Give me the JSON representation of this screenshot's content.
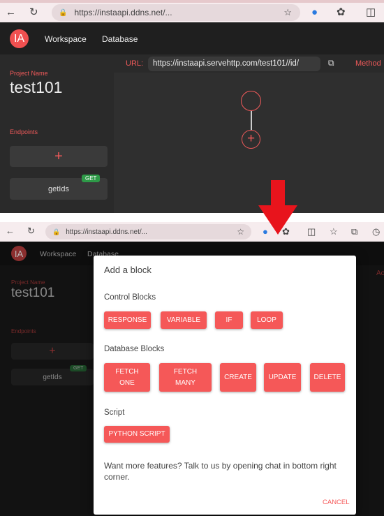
{
  "browser": {
    "url": "https://instaapi.ddns.net/..."
  },
  "app": {
    "logo": "IA",
    "nav": [
      "Workspace",
      "Database"
    ]
  },
  "sidebar": {
    "project_label": "Project Name",
    "project_name": "test101",
    "endpoints_label": "Endpoints",
    "add_symbol": "+",
    "endpoint": {
      "name": "getIds",
      "method": "GET"
    }
  },
  "toolbar": {
    "url_label": "URL:",
    "url_value": "https://instaapi.servehttp.com/test101//id/",
    "method_label": "Method",
    "partial_label": "Ac"
  },
  "canvas": {
    "add_symbol": "+"
  },
  "modal": {
    "title": "Add a block",
    "control_label": "Control Blocks",
    "control": [
      "RESPONSE",
      "VARIABLE",
      "IF",
      "LOOP"
    ],
    "database_label": "Database Blocks",
    "database": [
      "FETCH ONE",
      "FETCH MANY",
      "CREATE",
      "UPDATE",
      "DELETE"
    ],
    "script_label": "Script",
    "script": [
      "PYTHON SCRIPT"
    ],
    "note": "Want more features? Talk to us by opening chat in bottom right corner.",
    "cancel": "CANCEL"
  },
  "colors": {
    "accent": "#f55858",
    "badge": "#2e9a48",
    "arrow": "#e8141c"
  }
}
